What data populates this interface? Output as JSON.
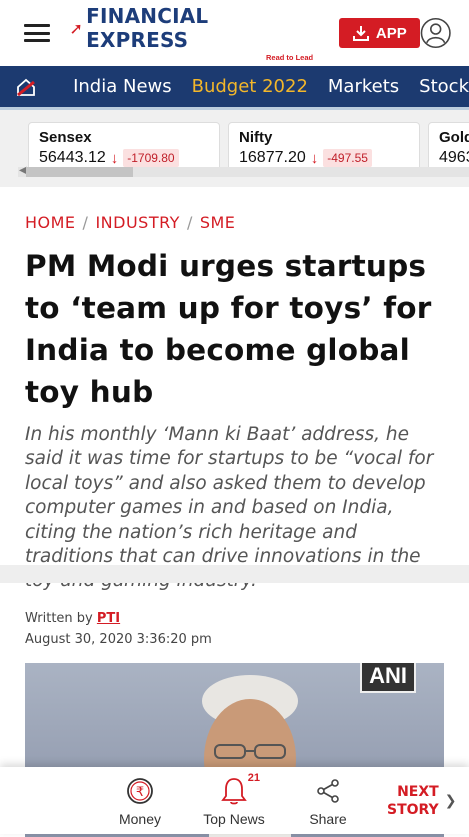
{
  "header": {
    "logo_text": "FINANCIAL EXPRESS",
    "logo_tagline": "Read to Lead",
    "app_button": "APP"
  },
  "nav": {
    "items": [
      {
        "label": "India News"
      },
      {
        "label": "Budget 2022"
      },
      {
        "label": "Markets"
      },
      {
        "label": "Stock"
      }
    ]
  },
  "tickers": [
    {
      "name": "Sensex",
      "price": "56443.12",
      "change": "-1709.80"
    },
    {
      "name": "Nifty",
      "price": "16877.20",
      "change": "-497.55"
    },
    {
      "name": "Gold",
      "price": "4963"
    }
  ],
  "breadcrumb": [
    "HOME",
    "INDUSTRY",
    "SME"
  ],
  "article": {
    "headline": "PM Modi urges startups to ‘team up for toys’ for India to become global toy hub",
    "summary": "In his monthly ‘Mann ki Baat’ address, he said it was time for startups to be “vocal for local toys” and also asked them to develop computer games in and based on India, citing the nation’s rich heritage and traditions that can drive innovations in the toy and gaming industry.",
    "byline_prefix": "Written by",
    "author": "PTI",
    "date": "August 30, 2020 3:36:20 pm",
    "image_watermark": "ANI"
  },
  "bottom_bar": {
    "money": "Money",
    "top_news": "Top News",
    "top_news_badge": "21",
    "share": "Share",
    "next_line1": "NEXT",
    "next_line2": "STORY"
  },
  "colors": {
    "brand_red": "#d41c24",
    "nav_blue": "#1c3a70",
    "accent_yellow": "#f3b72a"
  }
}
